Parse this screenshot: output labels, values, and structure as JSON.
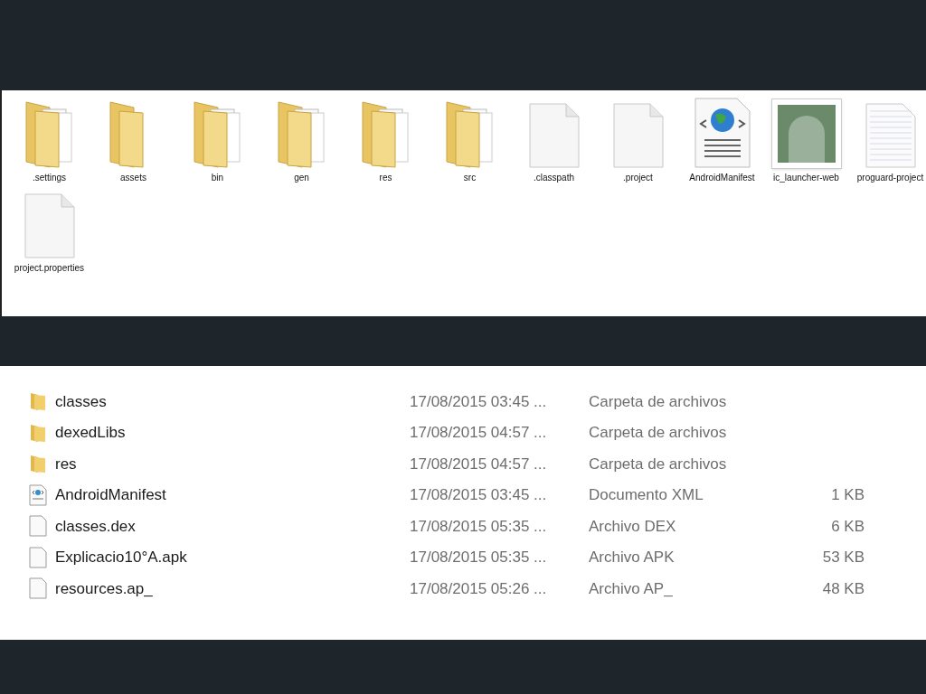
{
  "icon_view": {
    "items": [
      {
        "label": ".settings",
        "kind": "folder-docs"
      },
      {
        "label": "assets",
        "kind": "folder"
      },
      {
        "label": "bin",
        "kind": "folder-docs"
      },
      {
        "label": "gen",
        "kind": "folder-docs"
      },
      {
        "label": "res",
        "kind": "folder-docs"
      },
      {
        "label": "src",
        "kind": "folder-docs"
      },
      {
        "label": ".classpath",
        "kind": "file"
      },
      {
        "label": ".project",
        "kind": "file"
      },
      {
        "label": "AndroidManifest",
        "kind": "xml"
      },
      {
        "label": "ic_launcher-web",
        "kind": "photo"
      },
      {
        "label": "proguard-project",
        "kind": "text"
      },
      {
        "label": "project.properties",
        "kind": "file"
      }
    ]
  },
  "details_view": {
    "rows": [
      {
        "name": "classes",
        "date": "17/08/2015 03:45 ...",
        "type": "Carpeta de archivos",
        "kind": "folder"
      },
      {
        "name": "dexedLibs",
        "date": "17/08/2015 04:57 ...",
        "type": "Carpeta de archivos",
        "kind": "folder"
      },
      {
        "name": "res",
        "date": "17/08/2015 04:57 ...",
        "type": "Carpeta de archivos",
        "kind": "folder"
      },
      {
        "name": "AndroidManifest",
        "date": "17/08/2015 03:45 ...",
        "type": "Documento XML",
        "size": "1 KB",
        "kind": "xml"
      },
      {
        "name": "classes.dex",
        "date": "17/08/2015 05:35 ...",
        "type": "Archivo DEX",
        "size": "6 KB",
        "kind": "file"
      },
      {
        "name": "Explicacio10°A.apk",
        "date": "17/08/2015 05:35 ...",
        "type": "Archivo APK",
        "size": "53 KB",
        "kind": "file"
      },
      {
        "name": "resources.ap_",
        "date": "17/08/2015 05:26 ...",
        "type": "Archivo AP_",
        "size": "48 KB",
        "kind": "file"
      }
    ]
  }
}
